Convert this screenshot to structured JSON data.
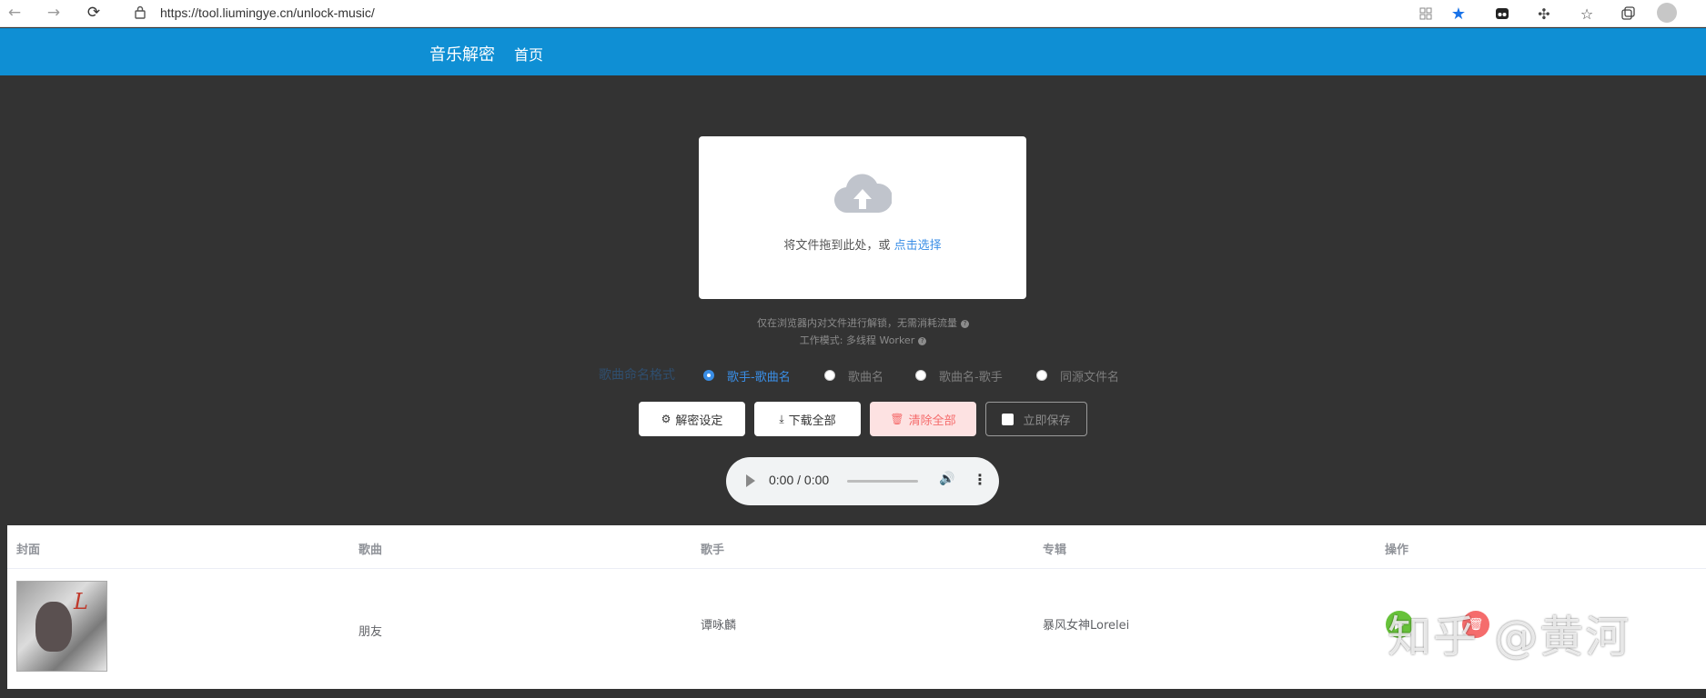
{
  "browser": {
    "url": "https://tool.liumingye.cn/unlock-music/"
  },
  "header": {
    "brand": "音乐解密",
    "home_link": "首页"
  },
  "upload": {
    "prompt": "将文件拖到此处，或",
    "select_link": "点击选择",
    "note_1": "仅在浏览器内对文件进行解锁，无需消耗流量",
    "note_2": "工作模式: 多线程 Worker"
  },
  "naming": {
    "label": "歌曲命名格式",
    "options": [
      "歌手-歌曲名",
      "歌曲名",
      "歌曲名-歌手",
      "同源文件名"
    ],
    "selected": "歌手-歌曲名"
  },
  "actions": {
    "settings": "解密设定",
    "download_all": "下载全部",
    "clear_all": "清除全部",
    "save_now": "立即保存"
  },
  "player": {
    "time": "0:00 / 0:00"
  },
  "table": {
    "columns": [
      "封面",
      "歌曲",
      "歌手",
      "专辑",
      "操作"
    ],
    "rows": [
      {
        "song": "朋友",
        "artist": "谭咏麟",
        "album": "暴风女神Lorelei"
      }
    ]
  },
  "watermark": "知乎 @黄河",
  "colors": {
    "header_bg": "#0f8fd4",
    "page_bg": "#333333",
    "accent": "#3a8ee6",
    "danger": "#f56c6c"
  }
}
